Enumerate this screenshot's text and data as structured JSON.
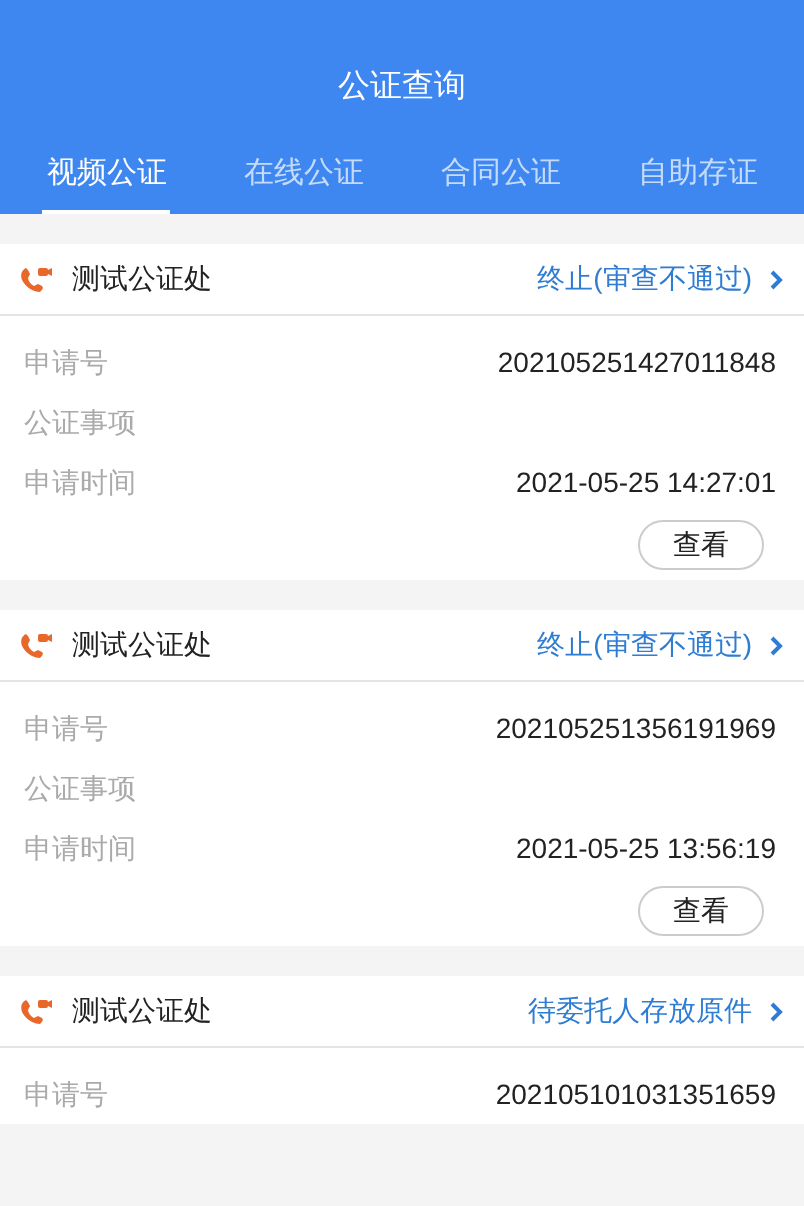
{
  "header": {
    "title": "公证查询"
  },
  "tabs": [
    {
      "label": "视频公证",
      "selected": true
    },
    {
      "label": "在线公证",
      "selected": false
    },
    {
      "label": "合同公证",
      "selected": false
    },
    {
      "label": "自助存证",
      "selected": false
    }
  ],
  "cards": [
    {
      "office": "测试公证处",
      "status": "终止(审查不通过)",
      "rows": [
        {
          "label": "申请号",
          "value": "202105251427011848"
        },
        {
          "label": "公证事项"
        },
        {
          "label": "申请时间",
          "value": "2021-05-25 14:27:01"
        }
      ],
      "button": "查看"
    },
    {
      "office": "测试公证处",
      "status": "终止(审查不通过)",
      "rows": [
        {
          "label": "申请号",
          "value": "202105251356191969"
        },
        {
          "label": "公证事项"
        },
        {
          "label": "申请时间",
          "value": "2021-05-25 13:56:19"
        }
      ],
      "button": "查看"
    },
    {
      "office": "测试公证处",
      "status": "待委托人存放原件",
      "rows": [
        {
          "label": "申请号",
          "value": "202105101031351659"
        }
      ]
    }
  ]
}
